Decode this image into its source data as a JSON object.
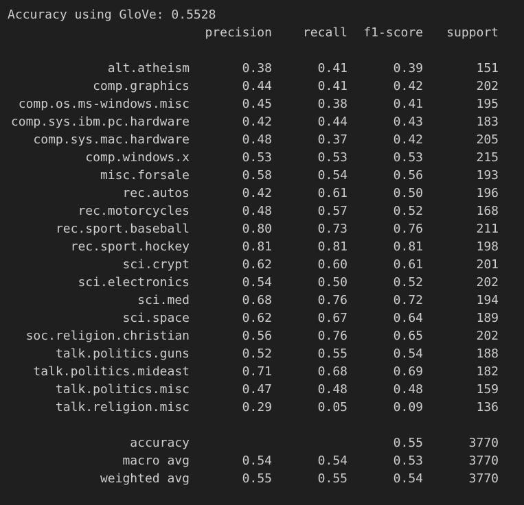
{
  "output": {
    "accuracy_line": "Accuracy using GloVe: 0.5528",
    "header": {
      "precision": "precision",
      "recall": "recall",
      "f1": "f1-score",
      "support": "support"
    },
    "rows": [
      {
        "label": "alt.atheism",
        "precision": "0.38",
        "recall": "0.41",
        "f1": "0.39",
        "support": "151"
      },
      {
        "label": "comp.graphics",
        "precision": "0.44",
        "recall": "0.41",
        "f1": "0.42",
        "support": "202"
      },
      {
        "label": "comp.os.ms-windows.misc",
        "precision": "0.45",
        "recall": "0.38",
        "f1": "0.41",
        "support": "195"
      },
      {
        "label": "comp.sys.ibm.pc.hardware",
        "precision": "0.42",
        "recall": "0.44",
        "f1": "0.43",
        "support": "183"
      },
      {
        "label": "comp.sys.mac.hardware",
        "precision": "0.48",
        "recall": "0.37",
        "f1": "0.42",
        "support": "205"
      },
      {
        "label": "comp.windows.x",
        "precision": "0.53",
        "recall": "0.53",
        "f1": "0.53",
        "support": "215"
      },
      {
        "label": "misc.forsale",
        "precision": "0.58",
        "recall": "0.54",
        "f1": "0.56",
        "support": "193"
      },
      {
        "label": "rec.autos",
        "precision": "0.42",
        "recall": "0.61",
        "f1": "0.50",
        "support": "196"
      },
      {
        "label": "rec.motorcycles",
        "precision": "0.48",
        "recall": "0.57",
        "f1": "0.52",
        "support": "168"
      },
      {
        "label": "rec.sport.baseball",
        "precision": "0.80",
        "recall": "0.73",
        "f1": "0.76",
        "support": "211"
      },
      {
        "label": "rec.sport.hockey",
        "precision": "0.81",
        "recall": "0.81",
        "f1": "0.81",
        "support": "198"
      },
      {
        "label": "sci.crypt",
        "precision": "0.62",
        "recall": "0.60",
        "f1": "0.61",
        "support": "201"
      },
      {
        "label": "sci.electronics",
        "precision": "0.54",
        "recall": "0.50",
        "f1": "0.52",
        "support": "202"
      },
      {
        "label": "sci.med",
        "precision": "0.68",
        "recall": "0.76",
        "f1": "0.72",
        "support": "194"
      },
      {
        "label": "sci.space",
        "precision": "0.62",
        "recall": "0.67",
        "f1": "0.64",
        "support": "189"
      },
      {
        "label": "soc.religion.christian",
        "precision": "0.56",
        "recall": "0.76",
        "f1": "0.65",
        "support": "202"
      },
      {
        "label": "talk.politics.guns",
        "precision": "0.52",
        "recall": "0.55",
        "f1": "0.54",
        "support": "188"
      },
      {
        "label": "talk.politics.mideast",
        "precision": "0.71",
        "recall": "0.68",
        "f1": "0.69",
        "support": "182"
      },
      {
        "label": "talk.politics.misc",
        "precision": "0.47",
        "recall": "0.48",
        "f1": "0.48",
        "support": "159"
      },
      {
        "label": "talk.religion.misc",
        "precision": "0.29",
        "recall": "0.05",
        "f1": "0.09",
        "support": "136"
      }
    ],
    "summary": [
      {
        "label": "accuracy",
        "precision": "",
        "recall": "",
        "f1": "0.55",
        "support": "3770"
      },
      {
        "label": "macro avg",
        "precision": "0.54",
        "recall": "0.54",
        "f1": "0.53",
        "support": "3770"
      },
      {
        "label": "weighted avg",
        "precision": "0.55",
        "recall": "0.55",
        "f1": "0.54",
        "support": "3770"
      }
    ]
  },
  "colors": {
    "background": "#1f1f1f",
    "text": "#cccccc"
  }
}
